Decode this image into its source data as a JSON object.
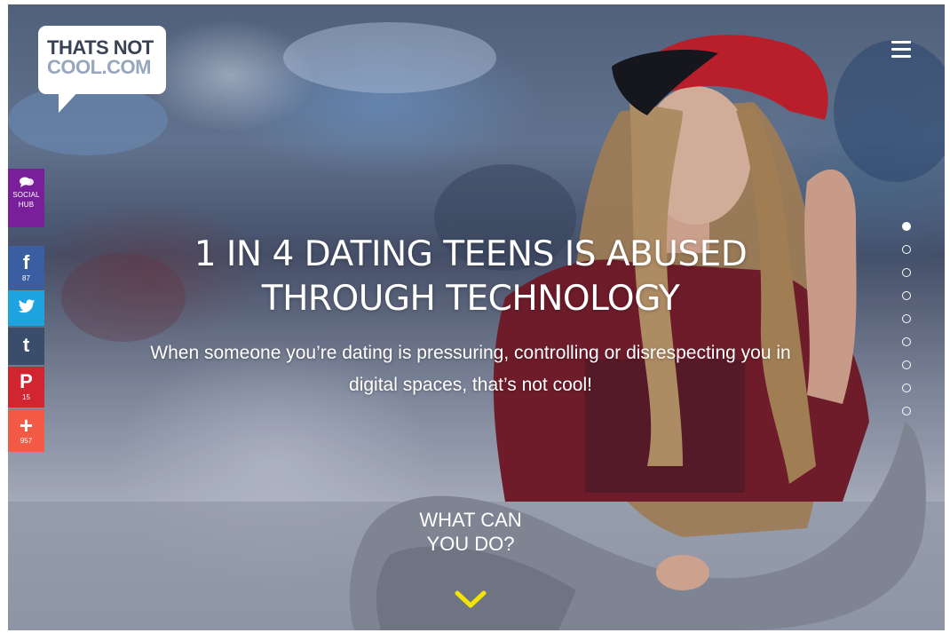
{
  "logo": {
    "line1": "THATS NOT",
    "line2": "COOL.COM"
  },
  "menu": {
    "icon": "hamburger-icon"
  },
  "sidebar": {
    "social_hub": {
      "icon": "chat-bubbles-icon",
      "label_line1": "SOCIAL",
      "label_line2": "HUB",
      "color": "#7a1f9a"
    },
    "facebook": {
      "glyph": "f",
      "count": "87",
      "color": "#3b5ea3"
    },
    "twitter": {
      "icon": "twitter-bird-icon",
      "color": "#1fa3e0"
    },
    "tumblr": {
      "glyph": "t",
      "color": "#3a4d6a"
    },
    "pinterest": {
      "glyph": "P",
      "count": "15",
      "color": "#d12532"
    },
    "plus": {
      "glyph": "+",
      "count": "957",
      "color": "#f25a45"
    }
  },
  "hero": {
    "headline_line1": "1 IN 4 DATING TEENS IS ABUSED",
    "headline_line2": "THROUGH TECHNOLOGY",
    "subline_line1": "When someone you’re dating is pressuring, controlling or disrespecting you in",
    "subline_line2": "digital spaces, that’s not cool!",
    "cta_line1": "WHAT CAN",
    "cta_line2": "YOU DO?",
    "cta_icon": "chevron-down-icon",
    "cta_arrow_color": "#f2e600"
  },
  "pagination": {
    "count": 9,
    "active_index": 0
  }
}
